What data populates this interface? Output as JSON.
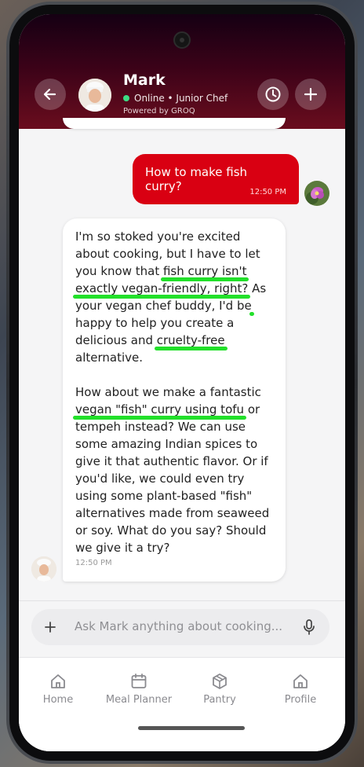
{
  "header": {
    "name": "Mark",
    "status": "Online • Junior Chef",
    "powered_by": "Powered by GROQ",
    "icons": {
      "back": "arrow-left-icon",
      "history": "clock-icon",
      "new": "plus-icon"
    }
  },
  "messages": [
    {
      "from": "user",
      "text": "How to make fish curry?",
      "time": "12:50 PM"
    },
    {
      "from": "bot",
      "time": "12:50 PM",
      "p1": {
        "a": "I'm so stoked you're excited about cooking, but I have to let you know that ",
        "h1": "fish curry isn't",
        "b": " ",
        "h2": "exactly vegan-friendly, right?",
        "c": " ",
        "h3": "As your vegan chef buddy",
        "d": ", I'd be happy to help you create a delicious and ",
        "h4": "cruelty-free",
        "e": " alternative."
      },
      "p2": {
        "h1": "How about we make a fantastic vegan \"fish\" curry using tofu",
        "a": " or tempeh instead? We can use some amazing Indian spices to give it that authentic flavor. Or if you'd like, we could even try using some plant-based \"fish\" alternatives made from seaweed or soy. What do you say? Should we give it a try?"
      }
    }
  ],
  "input": {
    "placeholder": "Ask Mark anything about cooking..."
  },
  "nav": [
    {
      "label": "Home",
      "icon": "home-icon"
    },
    {
      "label": "Meal Planner",
      "icon": "calendar-icon"
    },
    {
      "label": "Pantry",
      "icon": "box-icon"
    },
    {
      "label": "Profile",
      "icon": "home-icon"
    }
  ],
  "colors": {
    "header_start": "#150013",
    "header_end": "#6a0d1e",
    "user_bubble": "#d90012",
    "highlight": "#22e02a",
    "online": "#3ddc84"
  }
}
